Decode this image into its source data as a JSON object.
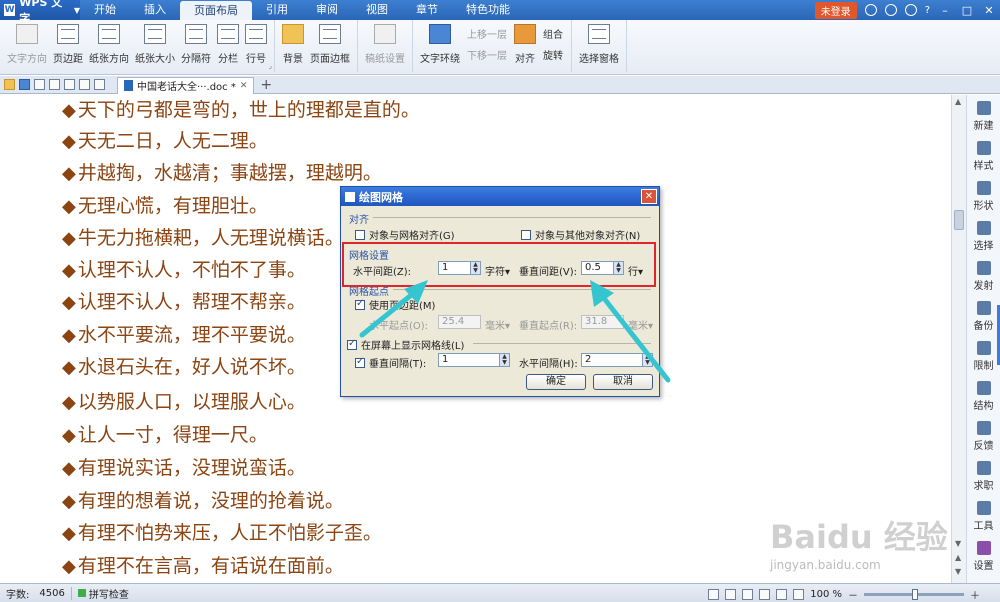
{
  "app": {
    "name": "WPS 文字"
  },
  "menu": [
    "开始",
    "插入",
    "页面布局",
    "引用",
    "审阅",
    "视图",
    "章节",
    "特色功能"
  ],
  "active_menu": "页面布局",
  "title_right": {
    "login": "未登录",
    "help": "?"
  },
  "ribbon": {
    "text_direction": "文字方向",
    "margins": "页边距",
    "orientation": "纸张方向",
    "paper_size": "纸张大小",
    "breaks": "分隔符",
    "columns": "分栏",
    "line_numbers": "行号",
    "background": "背景",
    "page_border": "页面边框",
    "manuscript": "稿纸设置",
    "text_wrap": "文字环绕",
    "bring_forward": "上移一层",
    "send_backward": "下移一层",
    "align": "对齐",
    "group": "组合",
    "rotate": "旋转",
    "selection_pane": "选择窗格"
  },
  "tab": {
    "doc_name": "中国老话大全···.doc *",
    "add": "+"
  },
  "document": {
    "lines": [
      "天下的弓都是弯的，世上的理都是直的。",
      "天无二日，人无二理。",
      "井越掏，水越清；事越摆，理越明。",
      "无理心慌，有理胆壮。",
      "牛无力拖横耙，人无理说横话。",
      "认理不认人，不怕不了事。",
      "认理不认人，帮理不帮亲。",
      "水不平要流，理不平要说。",
      "水退石头在，好人说不坏。",
      "以势服人口，以理服人心。",
      "让人一寸，得理一尺。",
      "有理说实话，没理说蛮话。",
      "有理的想着说，没理的抢着说。",
      "有理不怕势来压，人正不怕影子歪。",
      "有理不在言高，有话说在面前。"
    ]
  },
  "right_panel": [
    "新建",
    "样式",
    "形状",
    "选择",
    "发射",
    "备份",
    "限制",
    "结构",
    "反馈",
    "求职",
    "工具",
    "设置"
  ],
  "status": {
    "word_count_label": "字数:",
    "word_count": "4506",
    "spell": "拼写检查",
    "zoom": "100 %"
  },
  "dialog": {
    "title": "绘图网格",
    "sec_align": "对齐",
    "align_grid": "对象与网格对齐(G)",
    "align_other": "对象与其他对象对齐(N)",
    "sec_grid": "网格设置",
    "h_spacing_label": "水平间距(Z):",
    "h_spacing_value": "1",
    "h_unit": "字符",
    "v_spacing_label": "垂直间距(V):",
    "v_spacing_value": "0.5",
    "v_unit": "行",
    "sec_origin": "网格起点",
    "use_margins": "使用页边距(M)",
    "h_origin_label": "水平起点(O):",
    "h_origin_value": "25.4",
    "h_origin_unit": "毫米",
    "v_origin_label": "垂直起点(R):",
    "v_origin_value": "31.8",
    "v_origin_unit": "毫米",
    "show_grid": "在屏幕上显示网格线(L)",
    "v_interval_label": "垂直间隔(T):",
    "v_interval_value": "1",
    "h_interval_label": "水平间隔(H):",
    "h_interval_value": "2",
    "ok": "确定",
    "cancel": "取消"
  },
  "watermark": {
    "main": "Baidu 经验",
    "sub": "jingyan.baidu.com"
  },
  "colors": {
    "accent": "#2a66b8",
    "text": "#8b4513",
    "highlight": "#e0262b",
    "arrow": "#35c5d0"
  }
}
